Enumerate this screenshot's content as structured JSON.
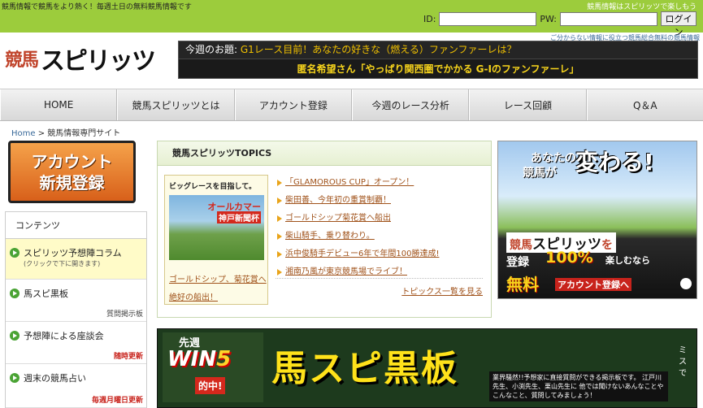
{
  "topbar": {
    "tagline": "競馬情報で競馬をより熱く！毎週土日の無料競馬情報です",
    "tagline_right": "競馬情報はスピリッツで楽しもう",
    "id_label": "ID:",
    "pw_label": "PW:",
    "login_button": "ログイン",
    "help": "ご分からない情報に役立つ競馬総合無料の競馬情報"
  },
  "logo": {
    "kanji": "競馬",
    "name": "スピリッツ"
  },
  "topic_banner": {
    "prefix": "今週のお題:",
    "question": "G1レース目前！あなたの好きな（燃える）ファンファーレは？",
    "answer": "匿名希望さん「やっぱり関西圏でかかる G-Iのファンファーレ」"
  },
  "nav": [
    {
      "label": "HOME"
    },
    {
      "label": "競馬スピリッツとは"
    },
    {
      "label": "アカウント登録"
    },
    {
      "label": "今週のレース分析"
    },
    {
      "label": "レース回顧"
    },
    {
      "label": "Q＆A"
    }
  ],
  "breadcrumb": {
    "home": "Home",
    "sep": ">",
    "current": "競馬情報専門サイト"
  },
  "register_button": {
    "line1": "アカウント",
    "line2": "新規登録"
  },
  "sidebar": {
    "title": "コンテンツ",
    "items": [
      {
        "label": "スピリッツ予想陣コラム",
        "sub": "(クリックで下に開きます)",
        "right": ""
      },
      {
        "label": "馬スピ黒板",
        "sub": "",
        "right": "質問掲示板"
      },
      {
        "label": "予想陣による座談会",
        "sub": "",
        "right": "随時更新"
      },
      {
        "label": "週末の競馬占い",
        "sub": "",
        "right": "毎週月曜日更新"
      }
    ]
  },
  "topics": {
    "heading": "競馬スピリッツTOPICS",
    "feature": {
      "title": "ビッグレースを目指して。",
      "img_label1": "オールカマー",
      "img_label2": "神戸新聞杯",
      "caption1": "ゴールドシップ、菊花賞へ",
      "caption2": "絶好の船出！"
    },
    "items": [
      "「GLAMOROUS CUP」オープン！",
      "柴田善、今年初の重賞制覇！",
      "ゴールドシップ菊花賞へ船出",
      "柴山騎手、乗り替わり。",
      "浜中俊騎手デビュー6年で年間100勝達成!",
      "湘南乃風が東京競馬場でライブ！"
    ],
    "more": "トピックス一覧を見る"
  },
  "ad": {
    "line1": "あなたの",
    "line2": "競馬が",
    "big": "変わる!",
    "brand_k": "競馬",
    "brand_name": "スピリッツ",
    "brand_suffix": "を",
    "register": "登録",
    "percent": "100%",
    "enjoy": "楽しむなら",
    "free": "無料",
    "cta": "アカウント登録へ"
  },
  "board": {
    "prev_week": "先週",
    "win": "WIN",
    "win_num": "5",
    "hit": "的中!",
    "title": "馬スピ黒板",
    "note": "業界騒然!!予想家に直接質問ができる掲示板です。 江戸川先生、小渕先生、栗山先生に 他では聞けないあんなことやこんなこと、質問してみましょう！",
    "side": "ミスで"
  },
  "colors": {
    "topbar": "#9ccc3c",
    "accent_orange": "#d8601a",
    "link": "#a0521a",
    "gold": "#f7d41c"
  }
}
